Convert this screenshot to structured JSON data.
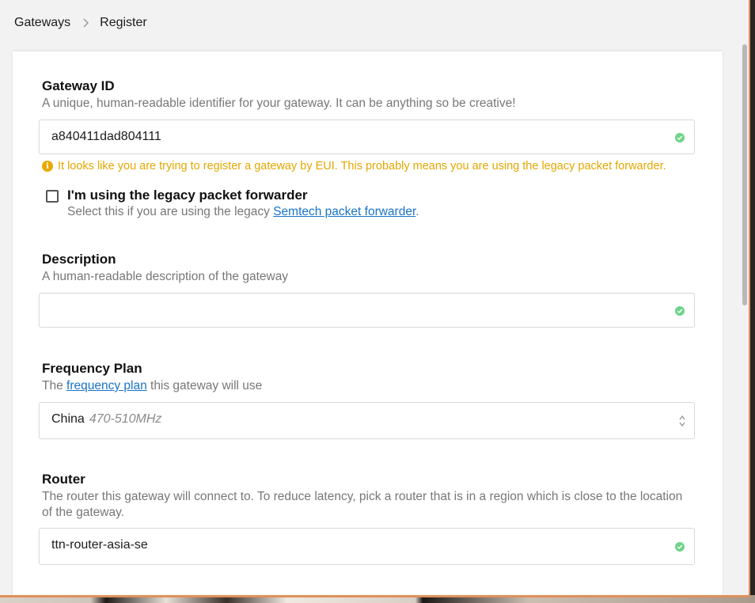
{
  "breadcrumb": {
    "items": [
      "Gateways",
      "Register"
    ]
  },
  "gateway_id": {
    "title": "Gateway ID",
    "description": "A unique, human-readable identifier for your gateway. It can be anything so be creative!",
    "value": "a840411dad804111",
    "warning": "It looks like you are trying to register a gateway by EUI. This probably means you are using the legacy packet forwarder."
  },
  "legacy": {
    "label": "I'm using the legacy packet forwarder",
    "desc_prefix": "Select this if you are using the legacy ",
    "link": "Semtech packet forwarder",
    "desc_suffix": ".",
    "checked": false
  },
  "description_field": {
    "title": "Description",
    "description": "A human-readable description of the gateway",
    "value": ""
  },
  "frequency_plan": {
    "title": "Frequency Plan",
    "desc_prefix": "The ",
    "link": "frequency plan",
    "desc_suffix": " this gateway will use",
    "selected": "China",
    "selected_sub": "470-510MHz"
  },
  "router": {
    "title": "Router",
    "description": "The router this gateway will connect to. To reduce latency, pick a router that is in a region which is close to the location of the gateway.",
    "value": "ttn-router-asia-se"
  },
  "colors": {
    "accent": "#1a73c6",
    "warning": "#e4a700",
    "valid": "#6fd38a",
    "window_border": "#e0905a"
  }
}
